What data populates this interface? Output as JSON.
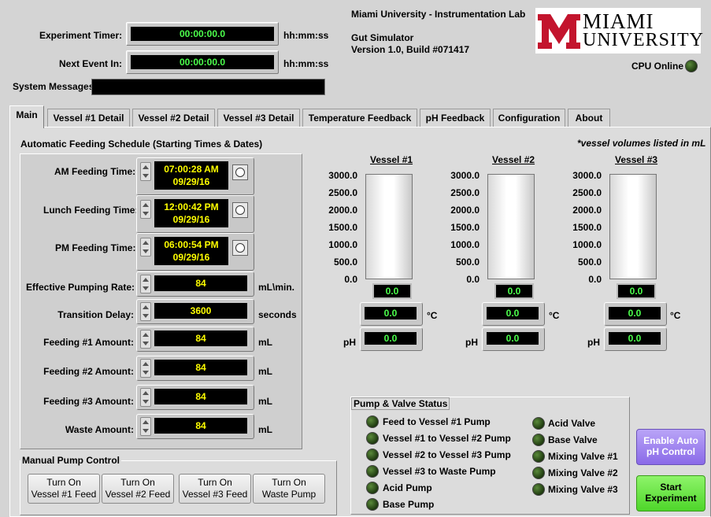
{
  "header": {
    "experiment_timer_label": "Experiment Timer:",
    "experiment_timer_value": "00:00:00.0",
    "experiment_timer_unit": "hh:mm:ss",
    "next_event_label": "Next Event In:",
    "next_event_value": "00:00:00.0",
    "next_event_unit": "hh:mm:ss",
    "system_messages_label": "System Messages",
    "system_messages_value": "",
    "lab_name": "Miami University - Instrumentation Lab",
    "app_name": "Gut Simulator",
    "version": "Version 1.0, Build #071417",
    "logo_line1": "MIAMI",
    "logo_line2": "UNIVERSITY",
    "cpu_label": "CPU Online"
  },
  "tabs": [
    "Main",
    "Vessel #1 Detail",
    "Vessel #2 Detail",
    "Vessel #3 Detail",
    "Temperature Feedback",
    "pH Feedback",
    "Configuration",
    "About"
  ],
  "feeding": {
    "title": "Automatic Feeding Schedule (Starting Times & Dates)",
    "am_label": "AM Feeding Time:",
    "am_time": "07:00:28 AM",
    "am_date": "09/29/16",
    "lunch_label": "Lunch Feeding Time:",
    "lunch_time": "12:00:42 PM",
    "lunch_date": "09/29/16",
    "pm_label": "PM Feeding Time:",
    "pm_time": "06:00:54 PM",
    "pm_date": "09/29/16",
    "rows": [
      {
        "label": "Effective Pumping Rate:",
        "value": "84",
        "unit": "mL\\min."
      },
      {
        "label": "Transition Delay:",
        "value": "3600",
        "unit": "seconds"
      },
      {
        "label": "Feeding #1 Amount:",
        "value": "84",
        "unit": "mL"
      },
      {
        "label": "Feeding #2 Amount:",
        "value": "84",
        "unit": "mL"
      },
      {
        "label": "Feeding #3 Amount:",
        "value": "84",
        "unit": "mL"
      },
      {
        "label": "Waste Amount:",
        "value": "84",
        "unit": "mL"
      }
    ]
  },
  "manual_pump": {
    "title": "Manual Pump Control",
    "buttons": [
      {
        "line1": "Turn On",
        "line2": "Vessel #1 Feed"
      },
      {
        "line1": "Turn On",
        "line2": "Vessel #2 Feed"
      },
      {
        "line1": "Turn On",
        "line2": "Vessel #3 Feed"
      },
      {
        "line1": "Turn On",
        "line2": "Waste Pump"
      }
    ]
  },
  "vessels": {
    "note": "*vessel volumes listed in mL",
    "scale": [
      "3000.0",
      "2500.0",
      "2000.0",
      "1500.0",
      "1000.0",
      "500.0",
      "0.0"
    ],
    "temp_unit": "°C",
    "ph_label": "pH",
    "items": [
      {
        "name": "Vessel #1",
        "volume": "0.0",
        "temp": "0.0",
        "ph": "0.0"
      },
      {
        "name": "Vessel #2",
        "volume": "0.0",
        "temp": "0.0",
        "ph": "0.0"
      },
      {
        "name": "Vessel #3",
        "volume": "0.0",
        "temp": "0.0",
        "ph": "0.0"
      }
    ]
  },
  "pump_status": {
    "title": "Pump & Valve Status",
    "left": [
      "Feed to Vessel #1 Pump",
      "Vessel #1 to Vessel #2 Pump",
      "Vessel #2 to Vessel #3 Pump",
      "Vessel #3 to Waste Pump",
      "Acid Pump",
      "Base Pump"
    ],
    "right": [
      "Acid Valve",
      "Base Valve",
      "Mixing Valve #1",
      "Mixing Valve #2",
      "Mixing Valve #3"
    ]
  },
  "actions": {
    "enable_ph_line1": "Enable Auto",
    "enable_ph_line2": "pH Control",
    "start_line1": "Start",
    "start_line2": "Experiment"
  },
  "colors": {
    "display_green": "#4cff4c",
    "display_yellow": "#ffff00",
    "logo_red": "#c3142d",
    "enable_button": "#9b7df0",
    "start_button": "#66ee33"
  }
}
